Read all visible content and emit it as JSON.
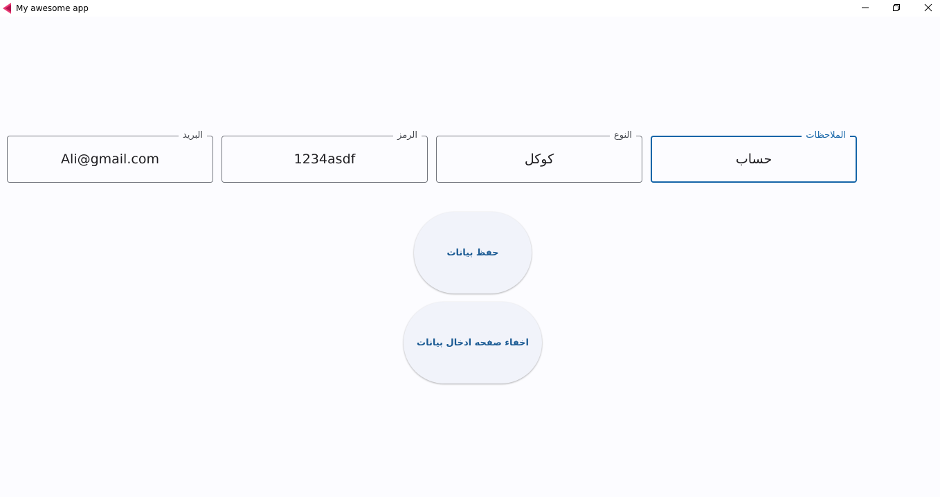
{
  "window": {
    "title": "My awesome app",
    "icons": [
      "app-icon",
      "minimize-icon",
      "maximize-icon",
      "close-icon"
    ]
  },
  "form": {
    "fields": [
      {
        "label": "البريد",
        "value": "Ali@gmail.com"
      },
      {
        "label": "الرمز",
        "value": "1234asdf"
      },
      {
        "label": "النوع",
        "value": "كوكل"
      },
      {
        "label": "الملاحظات",
        "value": "حساب"
      }
    ],
    "focused_field": "الملاحظات"
  },
  "buttons": {
    "save_label": "حفظ بيانات",
    "hide_label": "اخفاء صفحه ادخال بيانات"
  },
  "colors": {
    "accent": "#1565a8",
    "button_text": "#1a5a93",
    "button_bg": "#f1f3fa",
    "background": "#fcfcff"
  }
}
